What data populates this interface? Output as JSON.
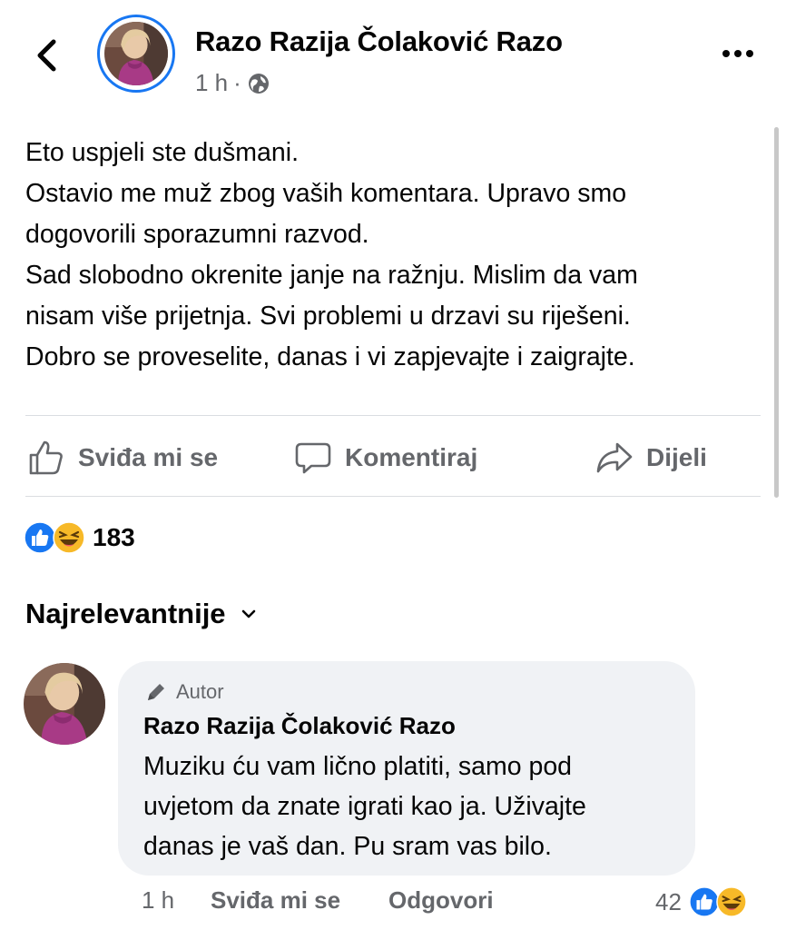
{
  "header": {
    "author_name": "Razo Razija Čolaković Razo",
    "time": "1 h",
    "separator": "·",
    "audience_icon": "globe-icon",
    "back_icon": "chevron-left-icon",
    "more_icon": "more-horizontal-icon"
  },
  "post": {
    "lines": [
      "Eto uspjeli ste dušmani.",
      "Ostavio me muž zbog vaših komentara. Upravo smo",
      "dogovorili sporazumni razvod.",
      "Sad slobodno okrenite janje na ražnju. Mislim da vam",
      "nisam više prijetnja. Svi problemi u drzavi su riješeni.",
      "Dobro se proveselite, danas i vi zapjevajte i zaigrajte."
    ]
  },
  "actions": {
    "like": "Sviđa mi se",
    "comment": "Komentiraj",
    "share": "Dijeli"
  },
  "reactions": {
    "count": "183",
    "types": [
      "like-reaction-icon",
      "haha-reaction-icon"
    ]
  },
  "comments_sort": {
    "label": "Najrelevantnije",
    "icon": "chevron-down-icon"
  },
  "comment": {
    "badge": "Autor",
    "badge_icon": "pencil-icon",
    "author": "Razo Razija Čolaković Razo",
    "lines": [
      "Muziku ću vam lično platiti, samo pod",
      "uvjetom da znate igrati kao ja. Uživajte",
      "danas je vaš dan. Pu sram vas bilo."
    ],
    "time": "1 h",
    "like": "Sviđa mi se",
    "reply": "Odgovori",
    "reaction_count": "42"
  },
  "colors": {
    "accent": "#1877f2",
    "secondary_text": "#65676b",
    "bubble_bg": "#f0f2f5",
    "haha": "#f7b928"
  }
}
